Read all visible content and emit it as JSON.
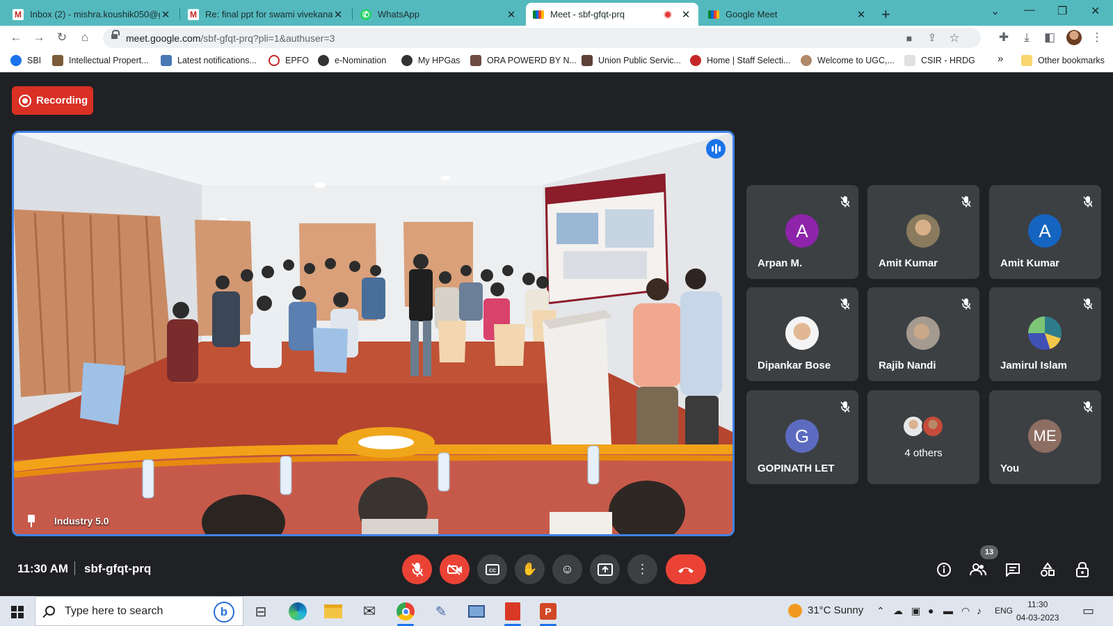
{
  "browser": {
    "tabs": [
      {
        "title": "Inbox (2) - mishra.koushik050@g",
        "icon": "gmail-icon",
        "active": false
      },
      {
        "title": "Re: final ppt for swami vivekanan",
        "icon": "gmail-icon",
        "active": false
      },
      {
        "title": "WhatsApp",
        "icon": "whatsapp-icon",
        "active": false
      },
      {
        "title": "Meet - sbf-gfqt-prq",
        "icon": "meet-icon",
        "active": true,
        "recording": true
      },
      {
        "title": "Google Meet",
        "icon": "meet-icon",
        "active": false
      }
    ],
    "url_host": "meet.google.com",
    "url_path": "/sbf-gfqt-prq?pli=1&authuser=3",
    "bookmarks": [
      {
        "label": "SBI",
        "color": "#1a73e8"
      },
      {
        "label": "Intellectual Propert...",
        "color": "#7b5b3a"
      },
      {
        "label": "Latest notifications...",
        "color": "#4a78b5"
      },
      {
        "label": "EPFO",
        "color": "#c62828"
      },
      {
        "label": "e-Nomination",
        "color": "#333333"
      },
      {
        "label": "My HPGas",
        "color": "#333333"
      },
      {
        "label": "ORA POWERD BY N...",
        "color": "#6d4c41"
      },
      {
        "label": "Union Public Servic...",
        "color": "#5d4037"
      },
      {
        "label": "Home | Staff Selecti...",
        "color": "#c62828"
      },
      {
        "label": "Welcome to UGC,...",
        "color": "#b08968"
      },
      {
        "label": "CSIR - HRDG",
        "color": "#bdbdbd"
      }
    ],
    "bookmarks_overflow": "»",
    "other_bookmarks": "Other bookmarks"
  },
  "meet": {
    "recording_label": "Recording",
    "main_tile": {
      "label": "Industry 5.0"
    },
    "participants": [
      {
        "name": "Arpan M.",
        "initial": "A",
        "color": "#8e24aa",
        "muted": true
      },
      {
        "name": "Amit Kumar",
        "initial": "",
        "color": "#9e8a6a",
        "muted": true
      },
      {
        "name": "Amit Kumar",
        "initial": "A",
        "color": "#1565c0",
        "muted": true
      },
      {
        "name": "Dipankar Bose",
        "initial": "",
        "color": "#e0c3a8",
        "muted": true
      },
      {
        "name": "Rajib Nandi",
        "initial": "",
        "color": "#b0a49a",
        "muted": true
      },
      {
        "name": "Jamirul Islam",
        "initial": "",
        "color": "#2e7d8c",
        "muted": true
      },
      {
        "name": "GOPINATH LET",
        "initial": "G",
        "color": "#5c6bc0",
        "muted": true
      },
      {
        "name": "You",
        "initial": "ME",
        "color": "#8d6e63",
        "muted": true
      }
    ],
    "others_label": "4 others",
    "time": "11:30 AM",
    "meeting_code": "sbf-gfqt-prq",
    "people_count": "13"
  },
  "taskbar": {
    "search_placeholder": "Type here to search",
    "weather": "31°C  Sunny",
    "language": "ENG",
    "time": "11:30",
    "date": "04-03-2023"
  }
}
